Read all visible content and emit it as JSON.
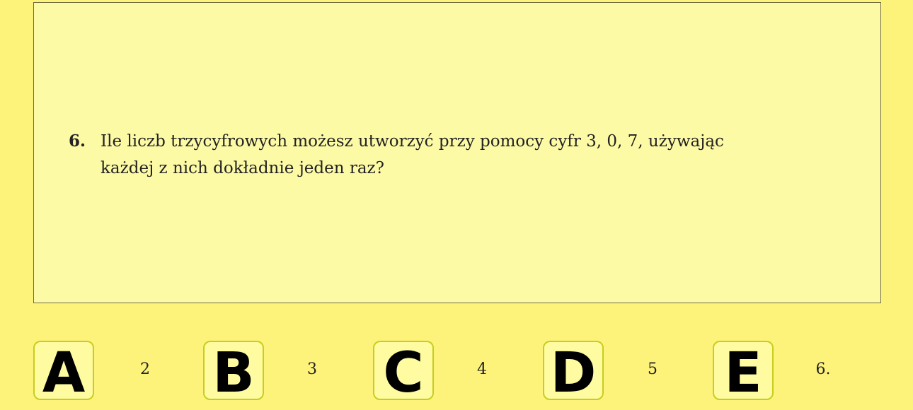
{
  "question": {
    "number": "6.",
    "text": "Ile liczb trzycyfrowych możesz utworzyć przy pomocy cyfr 3, 0, 7, używając\nkażdej z nich dokładnie jeden raz?"
  },
  "answers": [
    {
      "letter": "A",
      "value": "2"
    },
    {
      "letter": "B",
      "value": "3"
    },
    {
      "letter": "C",
      "value": "4"
    },
    {
      "letter": "D",
      "value": "5"
    },
    {
      "letter": "E",
      "value": "6."
    }
  ],
  "colors": {
    "background": "#fef37a",
    "panel": "#fdfaa6",
    "button_border": "#c7ce1f"
  }
}
